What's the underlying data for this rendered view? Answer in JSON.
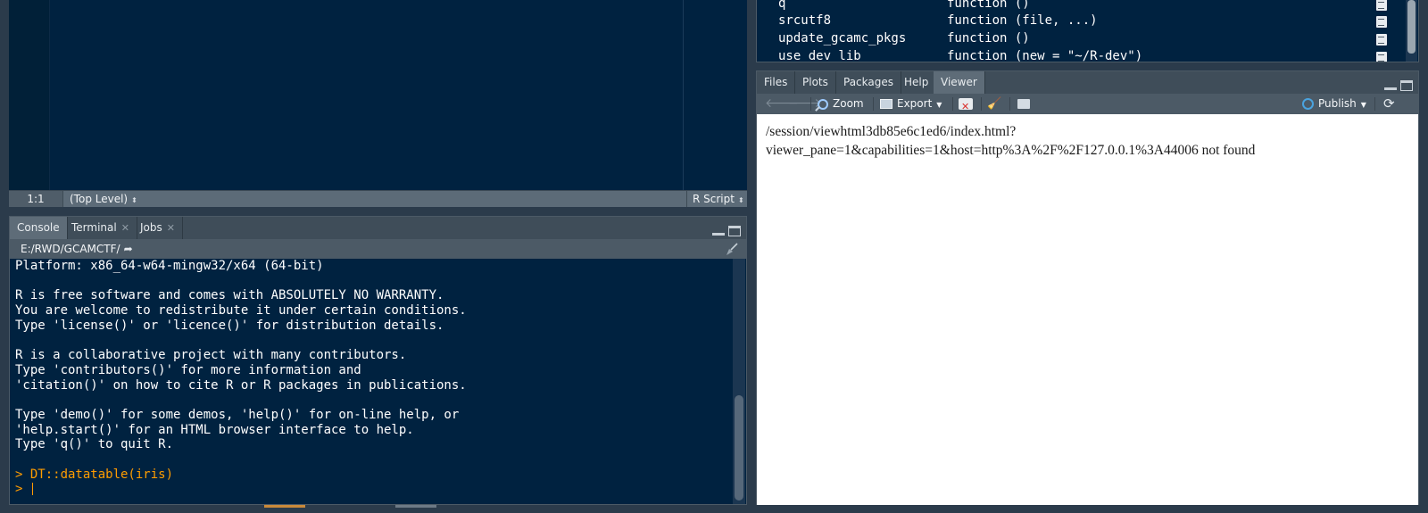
{
  "source": {
    "status": {
      "position": "1:1",
      "scope": "(Top Level)",
      "language": "R Script"
    }
  },
  "console": {
    "tabs": [
      {
        "label": "Console"
      },
      {
        "label": "Terminal"
      },
      {
        "label": "Jobs"
      }
    ],
    "path": "E:/RWD/GCAMCTF/",
    "lines": [
      "Platform: x86_64-w64-mingw32/x64 (64-bit)",
      "",
      "R is free software and comes with ABSOLUTELY NO WARRANTY.",
      "You are welcome to redistribute it under certain conditions.",
      "Type 'license()' or 'licence()' for distribution details.",
      "",
      "R is a collaborative project with many contributors.",
      "Type 'contributors()' for more information and",
      "'citation()' on how to cite R or R packages in publications.",
      "",
      "Type 'demo()' for some demos, 'help()' for on-line help, or",
      "'help.start()' for an HTML browser interface to help.",
      "Type 'q()' to quit R.",
      ""
    ],
    "command": "> DT::datatable(iris)",
    "prompt": "> "
  },
  "environment": {
    "rows": [
      {
        "name": "q",
        "value": "function ()"
      },
      {
        "name": "srcutf8",
        "value": "function (file, ...)"
      },
      {
        "name": "update_gcamc_pkgs",
        "value": "function ()"
      },
      {
        "name": "use_dev_lib",
        "value": "function (new = \"~/R-dev\")"
      }
    ]
  },
  "viewer": {
    "tabs": [
      {
        "label": "Files"
      },
      {
        "label": "Plots"
      },
      {
        "label": "Packages"
      },
      {
        "label": "Help"
      },
      {
        "label": "Viewer"
      }
    ],
    "toolbar": {
      "zoom": "Zoom",
      "export": "Export",
      "publish": "Publish"
    },
    "message_line1": "/session/viewhtml3db85e6c1ed6/index.html?",
    "message_line2": "viewer_pane=1&capabilities=1&host=http%3A%2F%2F127.0.0.1%3A44006 not found"
  },
  "colors": {
    "editor_bg": "#002240",
    "command": "#ff9d00",
    "chrome": "#4c5a66"
  }
}
